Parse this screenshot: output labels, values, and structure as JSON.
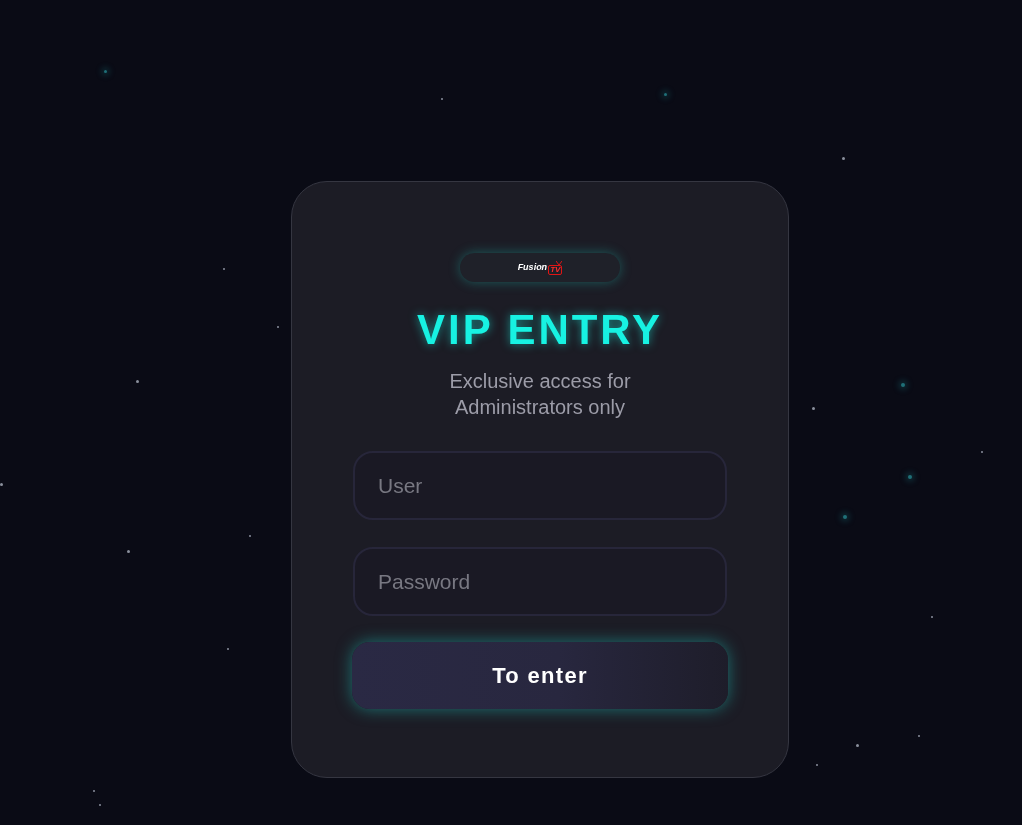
{
  "logo": {
    "name": "Fusion",
    "badge": "TV"
  },
  "title": "VIP ENTRY",
  "subtitle": "Exclusive access for Administrators only",
  "fields": [
    {
      "placeholder": "User"
    },
    {
      "placeholder": "Password"
    }
  ],
  "button": {
    "label": "To enter"
  }
}
